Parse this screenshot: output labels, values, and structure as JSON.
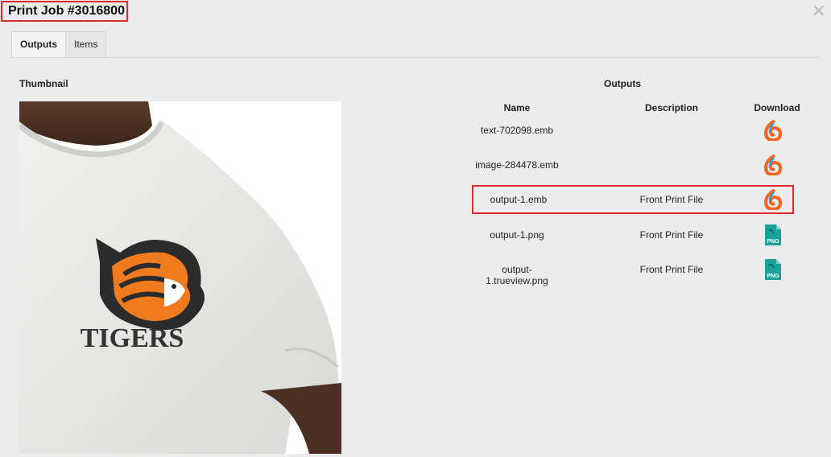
{
  "dialog": {
    "title": "Print Job #3016800",
    "close_glyph": "✕"
  },
  "tabs": [
    {
      "label": "Outputs",
      "active": true
    },
    {
      "label": "Items",
      "active": false
    }
  ],
  "thumbnail": {
    "label": "Thumbnail",
    "logo_text": "TIGERS"
  },
  "outputs": {
    "title": "Outputs",
    "columns": {
      "name": "Name",
      "description": "Description",
      "download": "Download"
    },
    "rows": [
      {
        "name": "text-702098.emb",
        "description": "",
        "icon": "emb-swirl-icon"
      },
      {
        "name": "image-284478.emb",
        "description": "",
        "icon": "emb-swirl-icon"
      },
      {
        "name": "output-1.emb",
        "description": "Front Print File",
        "icon": "emb-swirl-icon",
        "highlighted": true
      },
      {
        "name": "output-1.png",
        "description": "Front Print File",
        "icon": "png-file-icon"
      },
      {
        "name": "output-1.trueview.png",
        "description": "Front Print File",
        "icon": "png-file-icon"
      }
    ],
    "png_label": "PNG"
  },
  "colors": {
    "highlight": "#e0292b",
    "emb_orange": "#f26522",
    "emb_blue": "#1fa3d9",
    "png_teal": "#1aa39a"
  }
}
